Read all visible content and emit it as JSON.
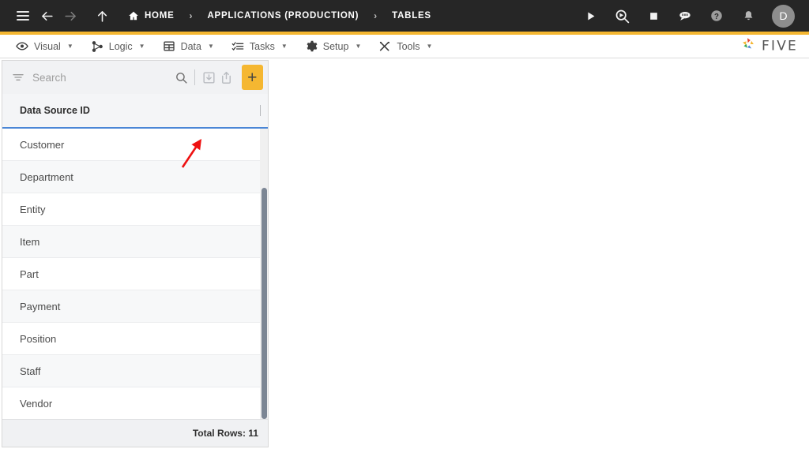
{
  "topbar": {
    "menu_icon": "hamburger-icon",
    "back_icon": "arrow-left-icon",
    "forward_icon": "arrow-right-icon",
    "up_icon": "arrow-up-icon",
    "breadcrumbs": [
      {
        "label": "HOME",
        "icon": "home-icon"
      },
      {
        "label": "APPLICATIONS (PRODUCTION)",
        "icon": ""
      },
      {
        "label": "TABLES",
        "icon": ""
      }
    ],
    "separator": "›",
    "actions": [
      {
        "name": "run-icon",
        "title": "Run"
      },
      {
        "name": "debug-icon",
        "title": "Debug"
      },
      {
        "name": "stop-icon",
        "title": "Stop"
      },
      {
        "name": "chat-bot-icon",
        "title": "Assistant"
      },
      {
        "name": "help-icon",
        "title": "Help"
      },
      {
        "name": "notifications-bell-icon",
        "title": "Notifications"
      }
    ],
    "avatar_initial": "D",
    "bg_color": "#262626",
    "accent_color": "#f5b731"
  },
  "menubar": {
    "items": [
      {
        "label": "Visual",
        "icon": "eye-icon",
        "caret": "▼"
      },
      {
        "label": "Logic",
        "icon": "nodes-icon",
        "caret": "▼"
      },
      {
        "label": "Data",
        "icon": "table-grid-icon",
        "caret": "▼"
      },
      {
        "label": "Tasks",
        "icon": "checklist-icon",
        "caret": "▼"
      },
      {
        "label": "Setup",
        "icon": "gear-icon",
        "caret": "▼"
      },
      {
        "label": "Tools",
        "icon": "tools-icon",
        "caret": "▼"
      }
    ],
    "brand": "FIVE"
  },
  "toolbar": {
    "filter_icon": "filter-icon",
    "search_placeholder": "Search",
    "search_value": "",
    "search_icon": "magnifier-icon",
    "import_icon": "import-icon",
    "export_icon": "export-icon",
    "add_label": "+"
  },
  "table": {
    "column_header": "Data Source ID",
    "rows": [
      {
        "name": "Customer"
      },
      {
        "name": "Department"
      },
      {
        "name": "Entity"
      },
      {
        "name": "Item"
      },
      {
        "name": "Part"
      },
      {
        "name": "Payment"
      },
      {
        "name": "Position"
      },
      {
        "name": "Staff"
      },
      {
        "name": "Vendor"
      }
    ],
    "footer_label": "Total Rows: 11",
    "header_underline_color": "#4a86d6"
  }
}
